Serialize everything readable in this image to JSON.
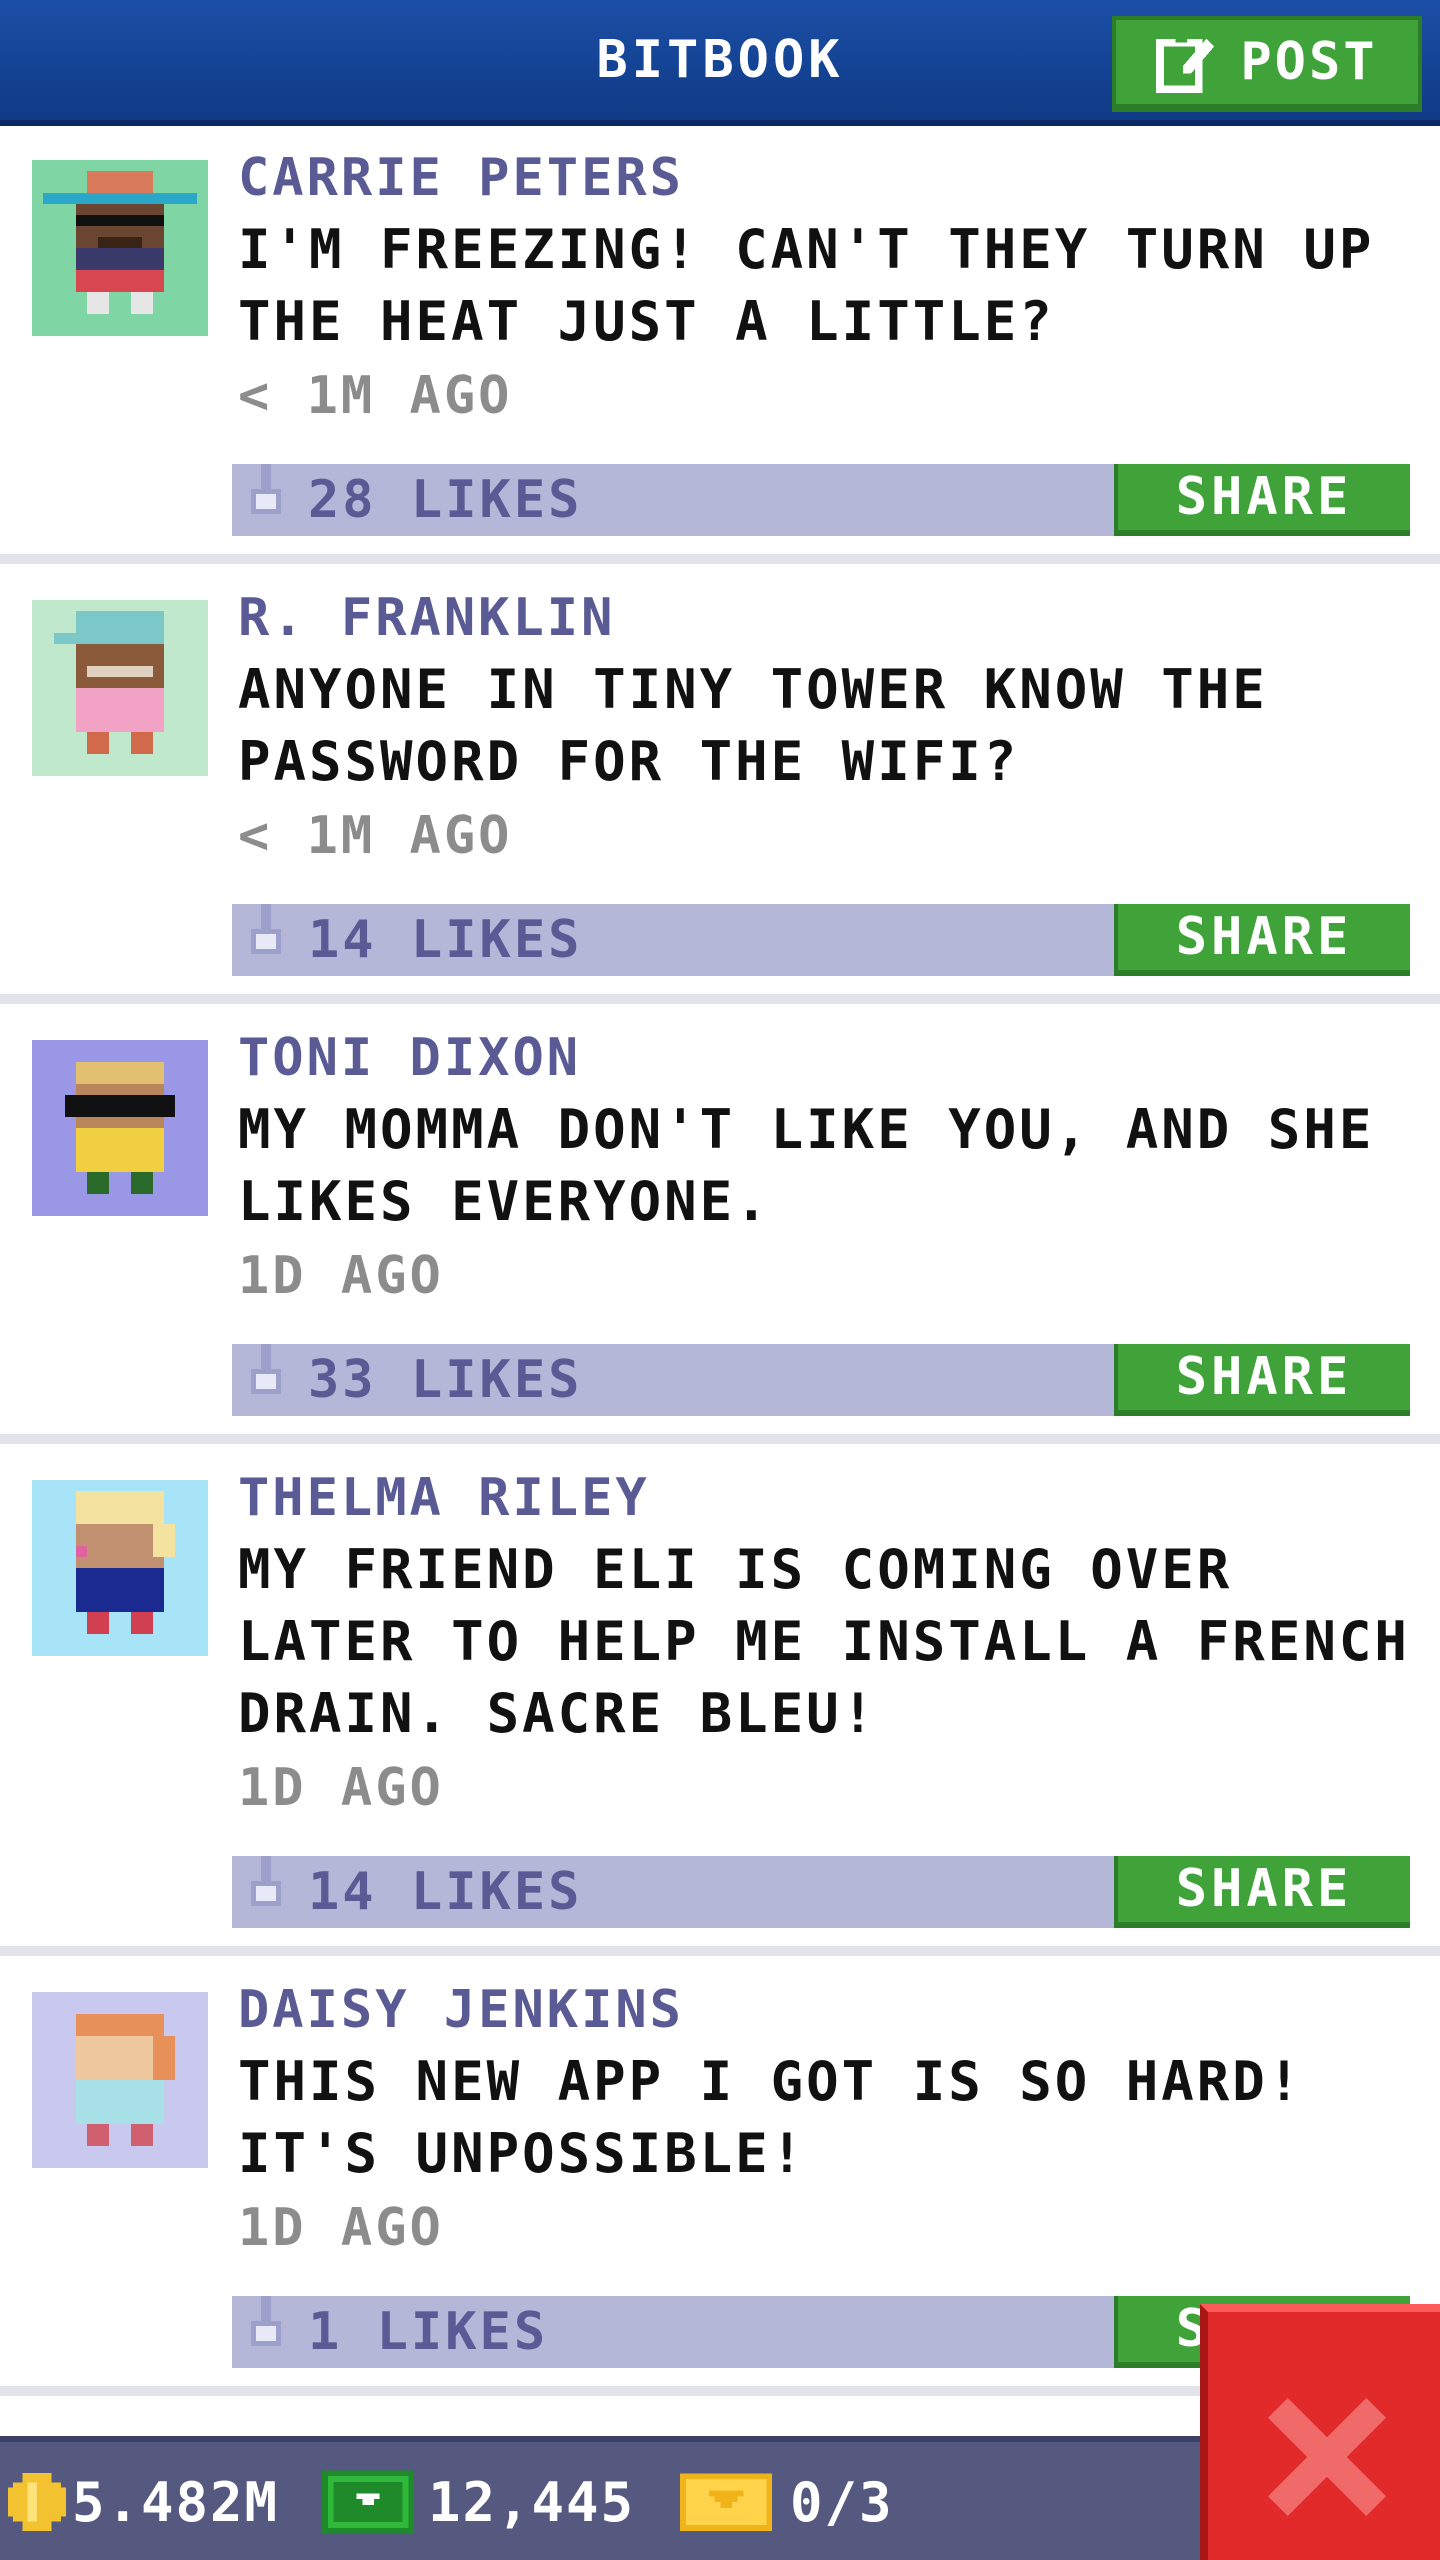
{
  "header": {
    "title": "BITBOOK",
    "post_label": "POST"
  },
  "posts": [
    {
      "author": "CARRIE PETERS",
      "message": "I'M FREEZING! CAN'T THEY TURN UP THE HEAT JUST A LITTLE?",
      "time": "< 1M AGO",
      "likes": "28 LIKES",
      "share_label": "SHARE",
      "avatar_bg": "#7fd6a4"
    },
    {
      "author": "R. FRANKLIN",
      "message": "ANYONE IN TINY TOWER KNOW THE PASSWORD FOR THE WIFI?",
      "time": "< 1M AGO",
      "likes": "14 LIKES",
      "share_label": "SHARE",
      "avatar_bg": "#bfe8cc"
    },
    {
      "author": "TONI DIXON",
      "message": "MY MOMMA DON'T LIKE YOU, AND SHE LIKES EVERYONE.",
      "time": "1D AGO",
      "likes": "33 LIKES",
      "share_label": "SHARE",
      "avatar_bg": "#9a98e6"
    },
    {
      "author": "THELMA RILEY",
      "message": "MY FRIEND ELI IS COMING OVER LATER TO HELP ME INSTALL A FRENCH DRAIN. SACRE BLEU!",
      "time": "1D AGO",
      "likes": "14 LIKES",
      "share_label": "SHARE",
      "avatar_bg": "#a8e4f8"
    },
    {
      "author": "DAISY JENKINS",
      "message": "THIS NEW APP I GOT IS SO HARD! IT'S UNPOSSIBLE!",
      "time": "1D AGO",
      "likes": "1 LIKES",
      "share_label": "SHARE",
      "avatar_bg": "#c9c9f0"
    }
  ],
  "footer": {
    "coins": "5.482M",
    "bux": "12,445",
    "tickets": "0/3"
  },
  "colors": {
    "header_blue": "#1b4fa6",
    "share_green": "#3fa33a",
    "likes_bar": "#b5b7d9",
    "author_text": "#5a5a94",
    "close_red": "#e22a2a",
    "footer_bg": "#55597f"
  },
  "icons": {
    "post": "edit-icon",
    "like": "thumbs-up-icon",
    "coin": "coin-icon",
    "bux": "bux-icon",
    "ticket": "ticket-icon",
    "close": "close-icon"
  }
}
